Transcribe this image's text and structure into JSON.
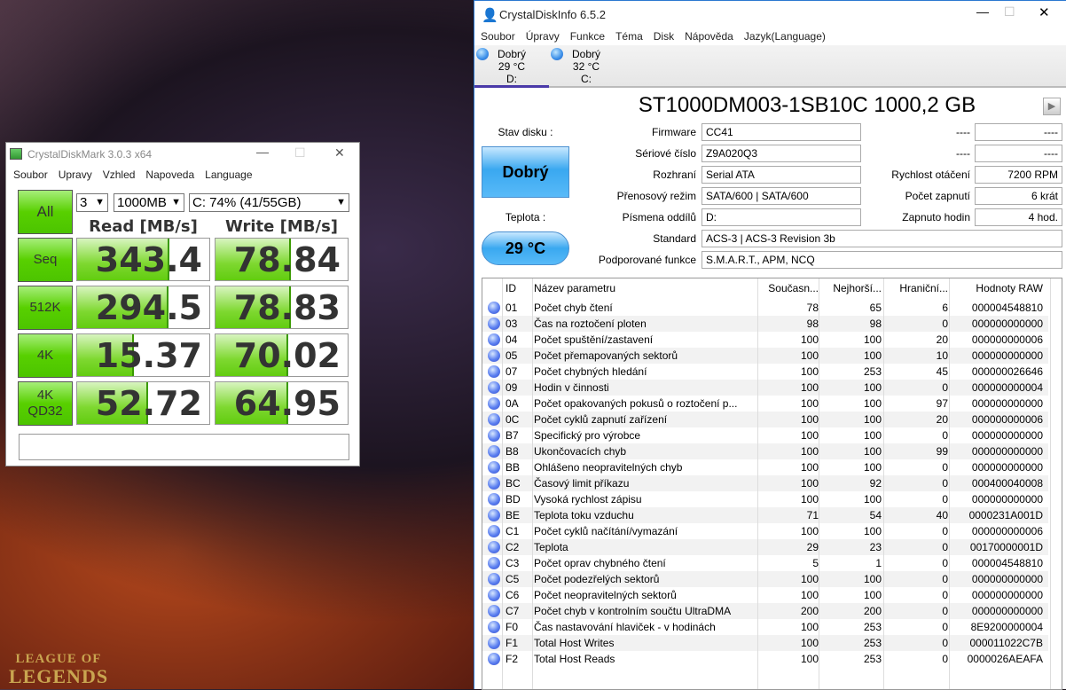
{
  "wallpaper": {
    "logo_line1": "LEAGUE OF",
    "logo_line2": "LEGENDS"
  },
  "cdm": {
    "title": "CrystalDiskMark 3.0.3 x64",
    "menu": [
      "Soubor",
      "Upravy",
      "Vzhled",
      "Napoveda",
      "Language"
    ],
    "all_label": "All",
    "count_select": "3",
    "size_select": "1000MB",
    "drive_select": "C: 74% (41/55GB)",
    "read_header": "Read [MB/s]",
    "write_header": "Write [MB/s]",
    "tests": [
      {
        "label": "Seq",
        "read": "343.4",
        "write": "78.84",
        "read_fill": 0.7,
        "write_fill": 0.57
      },
      {
        "label": "512K",
        "read": "294.5",
        "write": "78.83",
        "read_fill": 0.69,
        "write_fill": 0.57
      },
      {
        "label": "4K",
        "read": "15.37",
        "write": "70.02",
        "read_fill": 0.43,
        "write_fill": 0.55
      },
      {
        "label": "4K\nQD32",
        "read": "52.72",
        "write": "64.95",
        "read_fill": 0.54,
        "write_fill": 0.55
      }
    ],
    "status": ""
  },
  "cdi": {
    "title": "CrystalDiskInfo 6.5.2",
    "menu": [
      "Soubor",
      "Úpravy",
      "Funkce",
      "Téma",
      "Disk",
      "Nápověda",
      "Jazyk(Language)"
    ],
    "disks": [
      {
        "status": "Dobrý",
        "temp": "29 °C",
        "letter": "D:"
      },
      {
        "status": "Dobrý",
        "temp": "32 °C",
        "letter": "C:"
      }
    ],
    "model": "ST1000DM003-1SB10C 1000,2 GB",
    "health_label": "Stav disku :",
    "health": "Dobrý",
    "temp_label": "Teplota :",
    "temp": "29 °C",
    "fields": [
      {
        "label": "Firmware",
        "value": "CC41"
      },
      {
        "label": "Sériové číslo",
        "value": "Z9A020Q3"
      },
      {
        "label": "Rozhraní",
        "value": "Serial ATA"
      },
      {
        "label": "Přenosový režim",
        "value": "SATA/600 | SATA/600"
      },
      {
        "label": "Písmena oddílů",
        "value": "D:"
      }
    ],
    "right_fields": [
      {
        "label": "----",
        "value": "----"
      },
      {
        "label": "----",
        "value": "----"
      },
      {
        "label": "Rychlost otáčení",
        "value": "7200 RPM"
      },
      {
        "label": "Počet zapnutí",
        "value": "6 krát"
      },
      {
        "label": "Zapnuto hodin",
        "value": "4 hod."
      }
    ],
    "wide_fields": [
      {
        "label": "Standard",
        "value": "ACS-3 | ACS-3 Revision 3b"
      },
      {
        "label": "Podporované funkce",
        "value": "S.M.A.R.T., APM, NCQ"
      }
    ],
    "table_headers": [
      "ID",
      "Název parametru",
      "Současn...",
      "Nejhorší...",
      "Hraniční...",
      "Hodnoty RAW"
    ],
    "smart": [
      [
        "01",
        "Počet chyb čtení",
        "78",
        "65",
        "6",
        "000004548810"
      ],
      [
        "03",
        "Čas na roztočení ploten",
        "98",
        "98",
        "0",
        "000000000000"
      ],
      [
        "04",
        "Počet spuštění/zastavení",
        "100",
        "100",
        "20",
        "000000000006"
      ],
      [
        "05",
        "Počet přemapovaných sektorů",
        "100",
        "100",
        "10",
        "000000000000"
      ],
      [
        "07",
        "Počet chybných hledání",
        "100",
        "253",
        "45",
        "000000026646"
      ],
      [
        "09",
        "Hodin v činnosti",
        "100",
        "100",
        "0",
        "000000000004"
      ],
      [
        "0A",
        "Počet opakovaných pokusů o roztočení p...",
        "100",
        "100",
        "97",
        "000000000000"
      ],
      [
        "0C",
        "Počet cyklů zapnutí zařízení",
        "100",
        "100",
        "20",
        "000000000006"
      ],
      [
        "B7",
        "Specifický pro výrobce",
        "100",
        "100",
        "0",
        "000000000000"
      ],
      [
        "B8",
        "Ukončovacích chyb",
        "100",
        "100",
        "99",
        "000000000000"
      ],
      [
        "BB",
        "Ohlášeno neopravitelných chyb",
        "100",
        "100",
        "0",
        "000000000000"
      ],
      [
        "BC",
        "Časový limit příkazu",
        "100",
        "92",
        "0",
        "000400040008"
      ],
      [
        "BD",
        "Vysoká rychlost zápisu",
        "100",
        "100",
        "0",
        "000000000000"
      ],
      [
        "BE",
        "Teplota toku vzduchu",
        "71",
        "54",
        "40",
        "0000231A001D"
      ],
      [
        "C1",
        "Počet cyklů načítání/vymazání",
        "100",
        "100",
        "0",
        "000000000006"
      ],
      [
        "C2",
        "Teplota",
        "29",
        "23",
        "0",
        "00170000001D"
      ],
      [
        "C3",
        "Počet oprav chybného čtení",
        "5",
        "1",
        "0",
        "000004548810"
      ],
      [
        "C5",
        "Počet podezřelých sektorů",
        "100",
        "100",
        "0",
        "000000000000"
      ],
      [
        "C6",
        "Počet neopravitelných sektorů",
        "100",
        "100",
        "0",
        "000000000000"
      ],
      [
        "C7",
        "Počet chyb v kontrolním součtu UltraDMA",
        "200",
        "200",
        "0",
        "000000000000"
      ],
      [
        "F0",
        "Čas nastavování hlaviček - v hodinách",
        "100",
        "253",
        "0",
        "8E9200000004"
      ],
      [
        "F1",
        "Total Host Writes",
        "100",
        "253",
        "0",
        "000011022C7B"
      ],
      [
        "F2",
        "Total Host Reads",
        "100",
        "253",
        "0",
        "0000026AEAFA"
      ]
    ]
  }
}
